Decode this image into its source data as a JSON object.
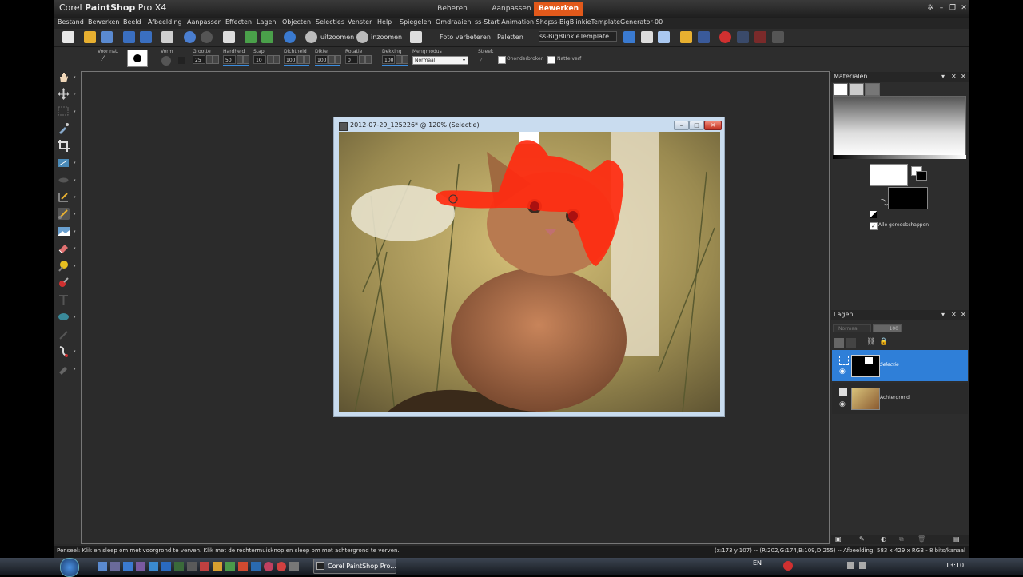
{
  "app": {
    "title_brand": "Corel",
    "title_product": "PaintShop",
    "title_version": "Pro X4",
    "workspace_tabs": [
      "Beheren",
      "Aanpassen",
      "Bewerken"
    ],
    "active_tab": "Bewerken"
  },
  "menu": [
    "Bestand",
    "Bewerken",
    "Beeld",
    "Afbeelding",
    "Aanpassen",
    "Effecten",
    "Lagen",
    "Objecten",
    "Selecties",
    "Venster",
    "Help",
    "Spiegelen",
    "Omdraaien",
    "ss-Start Animation Shop",
    "ss-BigBlinkieTemplateGenerator-00"
  ],
  "toolbar": {
    "zoom_out": "uitzoomen",
    "zoom_in": "inzoomen",
    "photo_fix": "Foto verbeteren",
    "palettes": "Paletten",
    "script_select": "ss-BigBlinkieTemplate..."
  },
  "options": {
    "preset_label": "Voorinst.",
    "shape_label": "Vorm",
    "size_label": "Grootte",
    "size_value": "25",
    "hardness_label": "Hardheid",
    "hardness_value": "50",
    "step_label": "Stap",
    "step_value": "10",
    "density_label": "Dichtheid",
    "density_value": "100",
    "thickness_label": "Dikte",
    "thickness_value": "100",
    "rotation_label": "Rotatie",
    "rotation_value": "0",
    "opacity_label": "Dekking",
    "opacity_value": "100",
    "blend_label": "Mengmodus",
    "blend_value": "Normaal",
    "stroke_label": "Streek",
    "continuous_label": "Ononderbroken",
    "wet_label": "Natte verf"
  },
  "image_window": {
    "title": "2012-07-29_125226* @ 120% (Selectie)"
  },
  "materials": {
    "title": "Materialen",
    "all_tools_label": "Alle gereedschappen"
  },
  "layers": {
    "title": "Lagen",
    "blend_value": "Normaal",
    "opacity_value": "100",
    "items": [
      {
        "name": "Selectie",
        "selected": true
      },
      {
        "name": "Achtergrond",
        "selected": false
      }
    ]
  },
  "status": {
    "left": "Penseel: Klik en sleep om met voorgrond te verven. Klik met de rechtermuisknop en sleep om met achtergrond te verven.",
    "right": "(x:173 y:107) -- (R:202,G:174,B:109,D:255) -- Afbeelding:  583 x 429 x RGB - 8 bits/kanaal"
  },
  "taskbar": {
    "active_app": "Corel PaintShop Pro...",
    "language": "EN",
    "clock": "13:10"
  },
  "colors": {
    "accent": "#e2591b",
    "selection_blue": "#2f7fd8",
    "panel_bg": "#2d2d2d"
  }
}
